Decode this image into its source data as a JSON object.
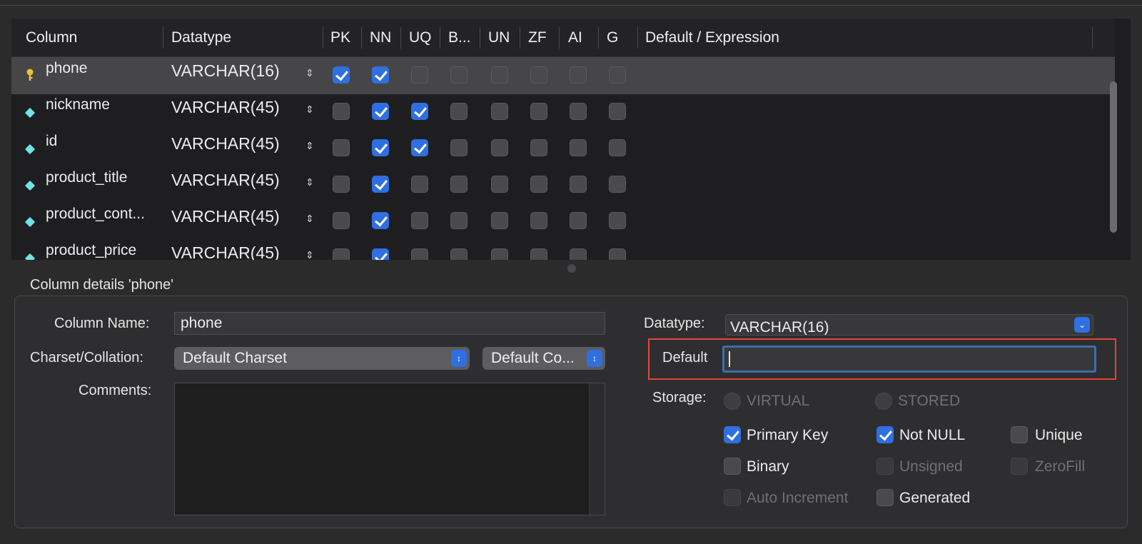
{
  "table": {
    "headers": [
      "Column",
      "Datatype",
      "PK",
      "NN",
      "UQ",
      "B...",
      "UN",
      "ZF",
      "AI",
      "G",
      "Default / Expression"
    ],
    "rows": [
      {
        "name": "phone",
        "type": "VARCHAR(16)",
        "icon": "primary-key-icon",
        "flags": [
          true,
          true,
          false,
          false,
          false,
          false,
          false,
          false
        ]
      },
      {
        "name": "nickname",
        "type": "VARCHAR(45)",
        "icon": "column-diamond-icon",
        "flags": [
          false,
          true,
          true,
          false,
          false,
          false,
          false,
          false
        ]
      },
      {
        "name": "id",
        "type": "VARCHAR(45)",
        "icon": "column-diamond-icon",
        "flags": [
          false,
          true,
          true,
          false,
          false,
          false,
          false,
          false
        ]
      },
      {
        "name": "product_title",
        "type": "VARCHAR(45)",
        "icon": "column-diamond-icon",
        "flags": [
          false,
          true,
          false,
          false,
          false,
          false,
          false,
          false
        ]
      },
      {
        "name": "product_cont...",
        "type": "VARCHAR(45)",
        "icon": "column-diamond-icon",
        "flags": [
          false,
          true,
          false,
          false,
          false,
          false,
          false,
          false
        ]
      },
      {
        "name": "product_price",
        "type": "VARCHAR(45)",
        "icon": "column-diamond-icon",
        "flags": [
          false,
          true,
          false,
          false,
          false,
          false,
          false,
          false
        ]
      }
    ]
  },
  "details": {
    "title": "Column details 'phone'",
    "column_name_label": "Column Name:",
    "column_name_value": "phone",
    "charset_label": "Charset/Collation:",
    "charset_value": "Default Charset",
    "collation_value": "Default Co...",
    "comments_label": "Comments:",
    "datatype_label": "Datatype:",
    "datatype_value": "VARCHAR(16)",
    "default_label": "Default",
    "default_value": "",
    "storage_label": "Storage:",
    "storage_virtual": "VIRTUAL",
    "storage_stored": "STORED",
    "options": {
      "primary_key": "Primary Key",
      "not_null": "Not NULL",
      "unique": "Unique",
      "binary": "Binary",
      "unsigned": "Unsigned",
      "zerofill": "ZeroFill",
      "auto_increment": "Auto Increment",
      "generated": "Generated"
    }
  },
  "colors": {
    "accent": "#2f6fe0",
    "highlight": "#e0473a",
    "focus": "#3a6fae"
  }
}
